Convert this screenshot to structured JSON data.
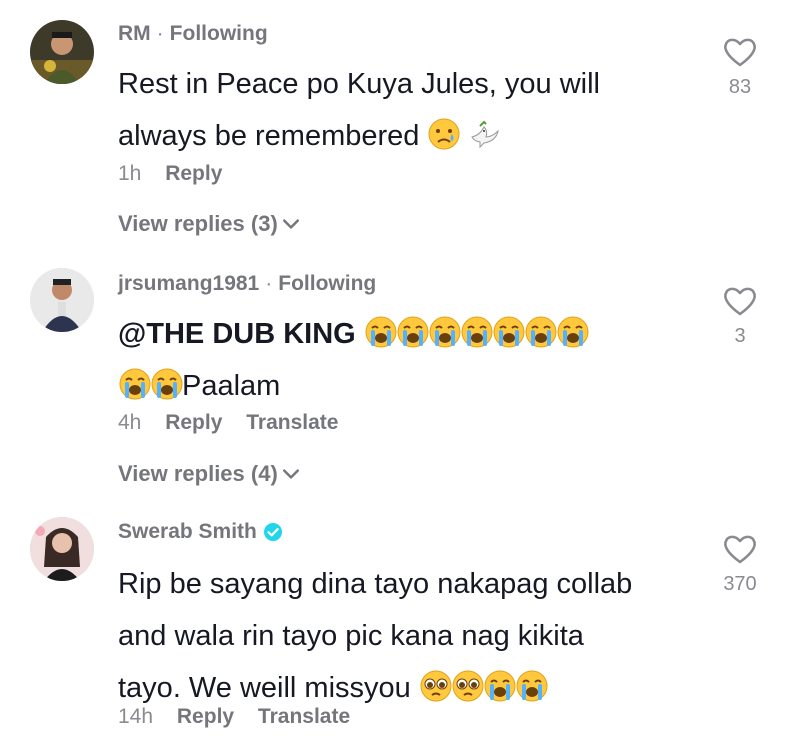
{
  "comments": [
    {
      "username": "RM",
      "follow_status": "Following",
      "verified": false,
      "text_lines": [
        "Rest in Peace po Kuya Jules, you will",
        "always be remembered"
      ],
      "emojis_after": [
        "crying-face",
        "dove"
      ],
      "time": "1h",
      "reply_label": "Reply",
      "translate_label": "",
      "view_replies": "View replies (3)",
      "likes": "83"
    },
    {
      "username": "jrsumang1981",
      "follow_status": "Following",
      "verified": false,
      "mention": "@THE DUB KING",
      "emojis_line1": [
        "loudly-crying-face",
        "loudly-crying-face",
        "loudly-crying-face",
        "loudly-crying-face",
        "loudly-crying-face",
        "loudly-crying-face",
        "loudly-crying-face"
      ],
      "emojis_line2": [
        "loudly-crying-face",
        "loudly-crying-face"
      ],
      "text_after_emojis": "Paalam",
      "time": "4h",
      "reply_label": "Reply",
      "translate_label": "Translate",
      "view_replies": "View replies (4)",
      "likes": "3"
    },
    {
      "username": "Swerab Smith",
      "follow_status": "",
      "verified": true,
      "text_lines": [
        "Rip be sayang dina tayo nakapag collab",
        "and wala rin tayo pic kana nag kikita",
        "tayo. We weill missyou"
      ],
      "emojis_after": [
        "pleading-face",
        "pleading-face",
        "loudly-crying-face",
        "loudly-crying-face"
      ],
      "time": "14h",
      "reply_label": "Reply",
      "translate_label": "Translate",
      "likes": "370"
    }
  ],
  "colors": {
    "primary_text": "#161823",
    "secondary_text": "#8a8b91",
    "verified_blue": "#20d5ec"
  },
  "icons": {
    "like": "heart-outline-icon",
    "chevron": "chevron-down-icon",
    "verified": "verified-badge-icon"
  }
}
